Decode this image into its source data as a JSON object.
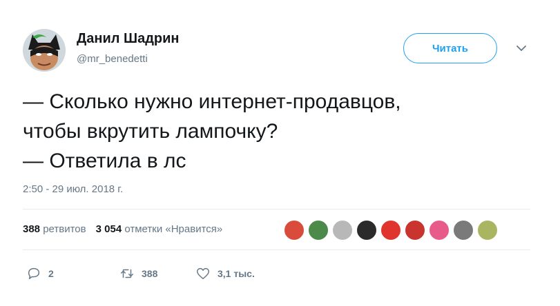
{
  "author": {
    "name": "Данил Шадрин",
    "handle": "@mr_benedetti"
  },
  "follow_label": "Читать",
  "tweet": {
    "lines": [
      "— Сколько нужно интернет-продавцов,",
      "чтобы вкрутить лампочку?",
      "— Ответила в лс"
    ],
    "timestamp": "2:50 - 29 июл. 2018 г."
  },
  "stats": {
    "retweets_count": "388",
    "retweets_label": "ретвитов",
    "likes_count": "3 054",
    "likes_label": "отметки «Нравится»"
  },
  "likers": [
    {
      "name": "liker-avatar-1",
      "color": "#d94b3b"
    },
    {
      "name": "liker-avatar-2",
      "color": "#4c8a4a"
    },
    {
      "name": "liker-avatar-3",
      "color": "#b8b8b8"
    },
    {
      "name": "liker-avatar-4",
      "color": "#2b2b2b"
    },
    {
      "name": "liker-avatar-5",
      "color": "#e0342f"
    },
    {
      "name": "liker-avatar-6",
      "color": "#c9342e"
    },
    {
      "name": "liker-avatar-7",
      "color": "#e85a8a"
    },
    {
      "name": "liker-avatar-8",
      "color": "#7a7a7a"
    },
    {
      "name": "liker-avatar-9",
      "color": "#a9b560"
    }
  ],
  "actions": {
    "replies": "2",
    "retweets": "388",
    "likes": "3,1 тыс."
  },
  "colors": {
    "accent": "#1da1f2",
    "secondary_text": "#657786",
    "divider": "#e6ecf0"
  }
}
